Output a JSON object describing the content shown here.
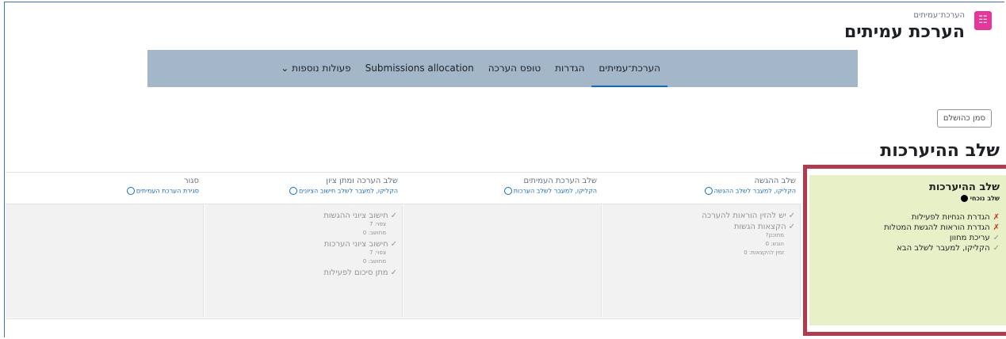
{
  "header": {
    "breadcrumb": "הערכת־עמיתים",
    "title": "הערכת עמיתים",
    "icon": "peer-review-icon"
  },
  "nav": {
    "items": [
      {
        "label": "הערכת־עמיתים",
        "active": true
      },
      {
        "label": "הגדרות",
        "active": false
      },
      {
        "label": "טופס הערכה",
        "active": false
      },
      {
        "label": "Submissions allocation",
        "active": false
      },
      {
        "label": "פעולות נוספות ⌄",
        "active": false
      }
    ]
  },
  "mark_done": "סמן כהושלם",
  "section_title": "שלב ההיערכות",
  "setup_phase": {
    "name": "שלב ההיערכות",
    "current": "שלב נוכחי",
    "tasks": [
      {
        "label": "הגדרת הנחיות לפעילות",
        "status": "x"
      },
      {
        "label": "הגדרת הוראות להגשת המטלות",
        "status": "x"
      },
      {
        "label": "עריכת מחוון",
        "status": "tick"
      },
      {
        "label": "הקליקו, למעבר לשלב הבא",
        "status": "tick"
      }
    ]
  },
  "phases": [
    {
      "name": "שלב ההגשה",
      "hint": "הקליקו, למעבר לשלב ההגשה",
      "tasks": [
        {
          "label": "יש להזין הוראות להערכה",
          "subs": []
        },
        {
          "label": "הקצאות הגשות",
          "subs": [
            "מתוכנן?",
            "הוגש: 0",
            "זמין להקצאות: 0"
          ]
        }
      ]
    },
    {
      "name": "שלב הערכת העמיתים",
      "hint": "הקליקו, למעבר לשלב הערכות",
      "tasks": []
    },
    {
      "name": "שלב הערכה ומתן ציון",
      "hint": "הקליקו, למעבר לשלב חישוב הציונים",
      "tasks": [
        {
          "label": "חישוב ציוני ההגשות",
          "subs": [
            "צפוי: 7",
            "מחושב: 0"
          ]
        },
        {
          "label": "חישוב ציוני הערכות",
          "subs": [
            "צפוי: 7",
            "מחושב: 0"
          ]
        },
        {
          "label": "מתן סיכום לפעילות",
          "subs": []
        }
      ]
    },
    {
      "name": "סגור",
      "hint": "סגירת הערכת העמיתים",
      "tasks": []
    }
  ]
}
